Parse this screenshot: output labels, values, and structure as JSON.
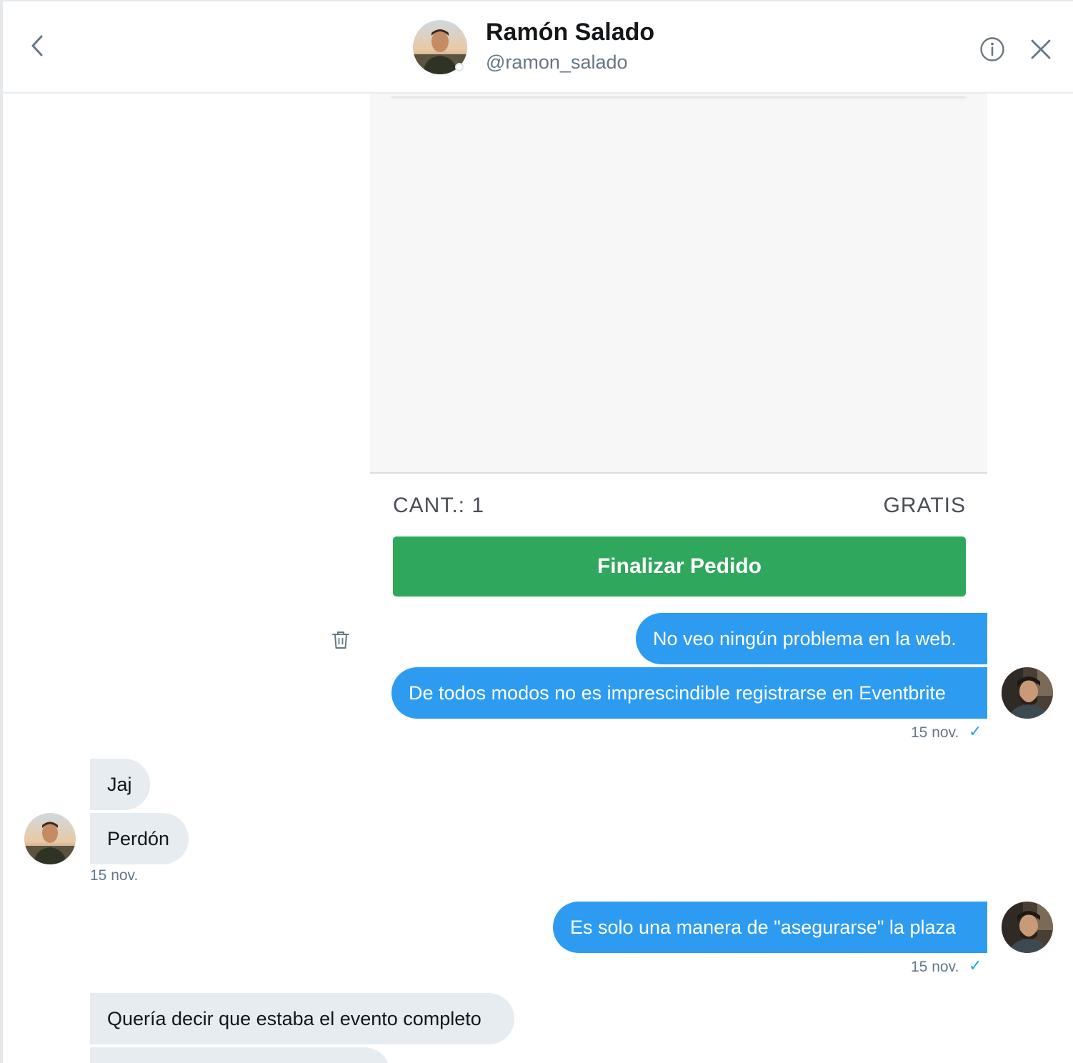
{
  "header": {
    "name": "Ramón Salado",
    "handle": "@ramon_salado"
  },
  "event_card": {
    "quantity_label": "CANT.: 1",
    "price_label": "GRATIS",
    "finish_button_label": "Finalizar Pedido",
    "button_color": "#2fa75d"
  },
  "messages": {
    "sent_group_1": [
      "No veo ningún problema en la web.",
      "De todos modos no es imprescindible registrarse en Eventbrite"
    ],
    "sent_group_1_time": "15 nov.",
    "recv_group_1": [
      "Jaj",
      "Perdón"
    ],
    "recv_group_1_time": "15 nov.",
    "sent_group_2": [
      "Es solo una manera de \"asegurarse\" la plaza"
    ],
    "sent_group_2_time": "15 nov.",
    "recv_group_2": [
      "Quería decir que estaba el evento completo"
    ]
  },
  "colors": {
    "sent_bubble": "#2d9cf0",
    "received_bubble": "#e6ecf0",
    "accent": "#1da1f2"
  },
  "icons": {
    "back": "chevron-left-icon",
    "info": "info-icon",
    "close": "close-icon",
    "delete": "trash-icon",
    "read": "check-icon"
  }
}
